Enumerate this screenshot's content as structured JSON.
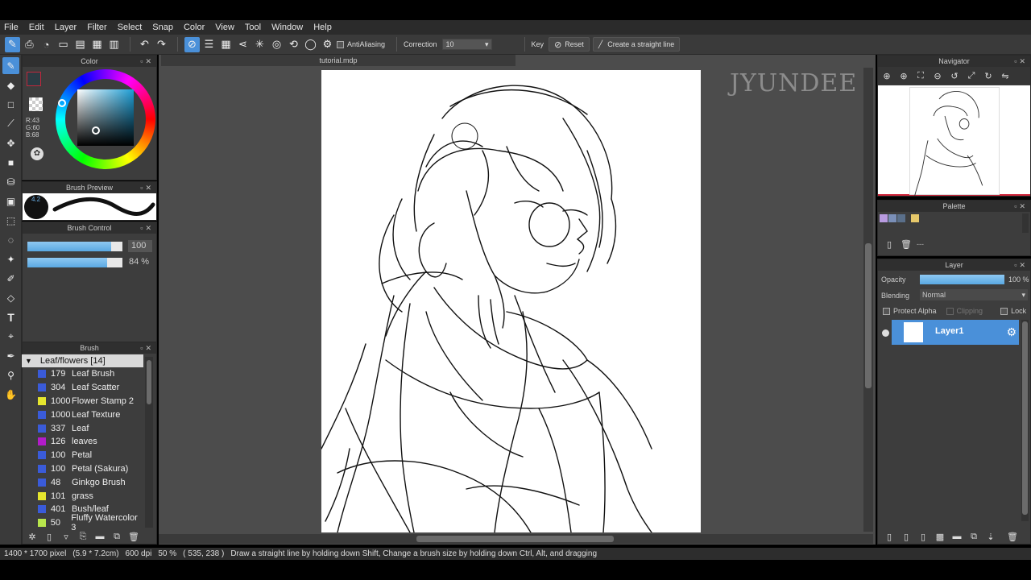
{
  "menu": [
    "File",
    "Edit",
    "Layer",
    "Filter",
    "Select",
    "Snap",
    "Color",
    "View",
    "Tool",
    "Window",
    "Help"
  ],
  "toolbar": {
    "antialias_label": "AntiAliasing",
    "correction_label": "Correction",
    "correction_value": "10",
    "key_label": "Key",
    "reset_label": "Reset",
    "straight_line_label": "Create a straight line"
  },
  "color_panel": {
    "title": "Color",
    "r": "R:43",
    "g": "G:60",
    "b": "B:68",
    "fg_color": "#2b3c44"
  },
  "brush_preview": {
    "title": "Brush Preview",
    "size": "4.2"
  },
  "brush_control": {
    "title": "Brush Control",
    "size_value": "100",
    "opacity_value": "84 %",
    "size_level": 0.88,
    "opacity_level": 0.84
  },
  "brush_panel": {
    "title": "Brush",
    "folder": "Leaf/flowers [14]",
    "items": [
      {
        "size": "179",
        "name": "Leaf Brush",
        "color": "#3a5bd9"
      },
      {
        "size": "304",
        "name": "Leaf Scatter",
        "color": "#3a5bd9"
      },
      {
        "size": "1000",
        "name": "Flower Stamp 2",
        "color": "#e6e62e"
      },
      {
        "size": "1000",
        "name": "Leaf Texture",
        "color": "#3a5bd9"
      },
      {
        "size": "337",
        "name": "Leaf",
        "color": "#3a5bd9"
      },
      {
        "size": "126",
        "name": "leaves",
        "color": "#b21cc9"
      },
      {
        "size": "100",
        "name": "Petal",
        "color": "#3a5bd9"
      },
      {
        "size": "100",
        "name": "Petal (Sakura)",
        "color": "#3a5bd9"
      },
      {
        "size": "48",
        "name": "Ginkgo Brush",
        "color": "#3a5bd9"
      },
      {
        "size": "101",
        "name": "grass",
        "color": "#e6e62e"
      },
      {
        "size": "401",
        "name": "Bush/leaf",
        "color": "#3a5bd9"
      },
      {
        "size": "50",
        "name": "Fluffy Watercolor 3",
        "color": "#b8e64c"
      }
    ]
  },
  "document": {
    "tab": "tutorial.mdp",
    "watermark": "JYUNDEE"
  },
  "navigator": {
    "title": "Navigator"
  },
  "palette": {
    "title": "Palette",
    "dash": "---",
    "swatches": [
      "#b89be0",
      "#7a8fb8",
      "#5a6f8a",
      "#e6c86a"
    ]
  },
  "layer_panel": {
    "title": "Layer",
    "opacity_label": "Opacity",
    "opacity_value": "100 %",
    "blending_label": "Blending",
    "blending_value": "Normal",
    "protect_alpha": "Protect Alpha",
    "clipping": "Clipping",
    "lock": "Lock",
    "layer_name": "Layer1"
  },
  "status": {
    "dims": "1400 * 1700 pixel",
    "cm": "(5.9 * 7.2cm)",
    "dpi": "600 dpi",
    "zoom": "50 %",
    "coords": "( 535, 238 )",
    "hint": "Draw a straight line by holding down Shift, Change a brush size by holding down Ctrl, Alt, and dragging"
  }
}
